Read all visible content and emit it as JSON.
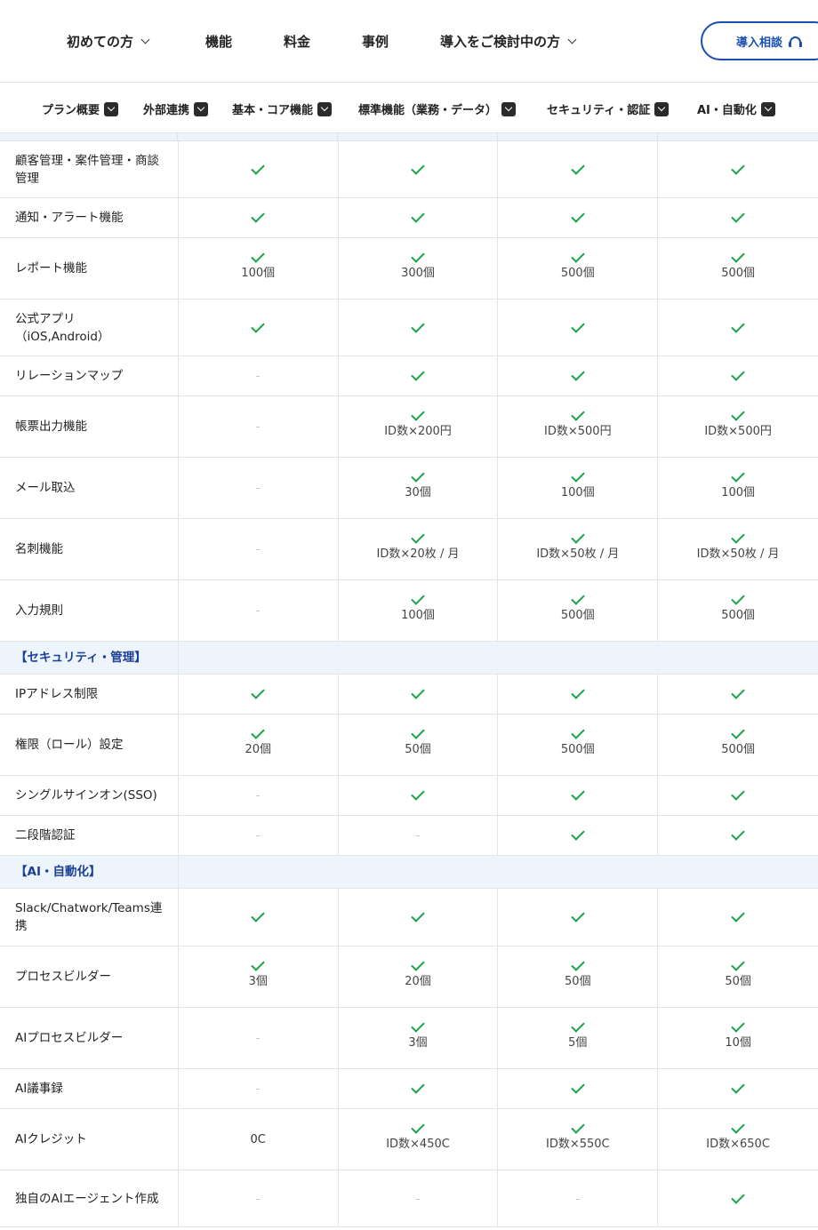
{
  "nav": {
    "items": [
      "初めての方",
      "機能",
      "料金",
      "事例",
      "導入をご検討中の方"
    ],
    "cta_label": "導入相談"
  },
  "tabs": [
    "プラン概要",
    "外部連携",
    "基本・コア機能",
    "標準機能（業務・データ）",
    "セキュリティ・認証",
    "AI・自動化"
  ],
  "table": {
    "rows": [
      {
        "label": "顧客管理・案件管理・商談管理",
        "cells": [
          {
            "check": true
          },
          {
            "check": true
          },
          {
            "check": true
          },
          {
            "check": true
          }
        ]
      },
      {
        "label": "通知・アラート機能",
        "cells": [
          {
            "check": true
          },
          {
            "check": true
          },
          {
            "check": true
          },
          {
            "check": true
          }
        ]
      },
      {
        "label": "レポート機能",
        "cells": [
          {
            "check": true,
            "note": "100個"
          },
          {
            "check": true,
            "note": "300個"
          },
          {
            "check": true,
            "note": "500個"
          },
          {
            "check": true,
            "note": "500個"
          }
        ]
      },
      {
        "label": "公式アプリ（iOS,Android）",
        "cells": [
          {
            "check": true
          },
          {
            "check": true
          },
          {
            "check": true
          },
          {
            "check": true
          }
        ]
      },
      {
        "label": "リレーションマップ",
        "cells": [
          {
            "text": "-"
          },
          {
            "check": true
          },
          {
            "check": true
          },
          {
            "check": true
          }
        ]
      },
      {
        "label": "帳票出力機能",
        "cells": [
          {
            "text": "-"
          },
          {
            "check": true,
            "note": "ID数×200円"
          },
          {
            "check": true,
            "note": "ID数×500円"
          },
          {
            "check": true,
            "note": "ID数×500円"
          }
        ]
      },
      {
        "label": "メール取込",
        "cells": [
          {
            "text": "-"
          },
          {
            "check": true,
            "note": "30個"
          },
          {
            "check": true,
            "note": "100個"
          },
          {
            "check": true,
            "note": "100個"
          }
        ]
      },
      {
        "label": "名刺機能",
        "cells": [
          {
            "text": "-"
          },
          {
            "check": true,
            "note": "ID数×20枚 / 月"
          },
          {
            "check": true,
            "note": "ID数×50枚 / 月"
          },
          {
            "check": true,
            "note": "ID数×50枚 / 月"
          }
        ]
      },
      {
        "label": "入力規則",
        "cells": [
          {
            "text": "-"
          },
          {
            "check": true,
            "note": "100個"
          },
          {
            "check": true,
            "note": "500個"
          },
          {
            "check": true,
            "note": "500個"
          }
        ]
      },
      {
        "section": "【セキュリティ・管理】"
      },
      {
        "label": "IPアドレス制限",
        "cells": [
          {
            "check": true
          },
          {
            "check": true
          },
          {
            "check": true
          },
          {
            "check": true
          }
        ]
      },
      {
        "label": "権限（ロール）設定",
        "cells": [
          {
            "check": true,
            "note": "20個"
          },
          {
            "check": true,
            "note": "50個"
          },
          {
            "check": true,
            "note": "500個"
          },
          {
            "check": true,
            "note": "500個"
          }
        ]
      },
      {
        "label": "シングルサインオン(SSO)",
        "cells": [
          {
            "text": "-"
          },
          {
            "check": true
          },
          {
            "check": true
          },
          {
            "check": true
          }
        ]
      },
      {
        "label": "二段階認証",
        "cells": [
          {
            "text": "-"
          },
          {
            "text": "-"
          },
          {
            "check": true
          },
          {
            "check": true
          }
        ]
      },
      {
        "section": "【AI・自動化】"
      },
      {
        "label": "Slack/Chatwork/Teams連携",
        "cells": [
          {
            "check": true
          },
          {
            "check": true
          },
          {
            "check": true
          },
          {
            "check": true
          }
        ]
      },
      {
        "label": "プロセスビルダー",
        "cells": [
          {
            "check": true,
            "note": "3個"
          },
          {
            "check": true,
            "note": "20個"
          },
          {
            "check": true,
            "note": "50個"
          },
          {
            "check": true,
            "note": "50個"
          }
        ]
      },
      {
        "label": "AIプロセスビルダー",
        "cells": [
          {
            "text": "-"
          },
          {
            "check": true,
            "note": "3個"
          },
          {
            "check": true,
            "note": "5個"
          },
          {
            "check": true,
            "note": "10個"
          }
        ]
      },
      {
        "label": "AI議事録",
        "cells": [
          {
            "text": "-"
          },
          {
            "check": true
          },
          {
            "check": true
          },
          {
            "check": true
          }
        ]
      },
      {
        "label": "AIクレジット",
        "cells": [
          {
            "text": "0C"
          },
          {
            "check": true,
            "note": "ID数×450C"
          },
          {
            "check": true,
            "note": "ID数×550C"
          },
          {
            "check": true,
            "note": "ID数×650C"
          }
        ]
      },
      {
        "label": "独自のAIエージェント作成",
        "cells": [
          {
            "text": "-"
          },
          {
            "text": "-"
          },
          {
            "text": "-"
          },
          {
            "check": true
          }
        ]
      }
    ]
  },
  "colors": {
    "accent": "#1a4fb0",
    "check": "#1aa34a",
    "section_bg": "#eef4fc",
    "section_text": "#1a3f94"
  }
}
